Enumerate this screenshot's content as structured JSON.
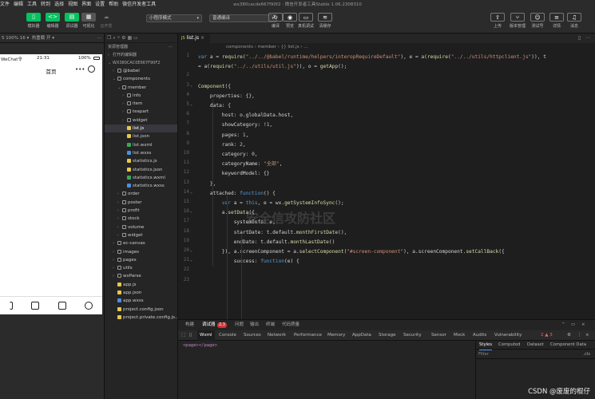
{
  "menubar": {
    "items": [
      "文件",
      "编辑",
      "工具",
      "转到",
      "选择",
      "视图",
      "界面",
      "设置",
      "帮助",
      "微信开发者工具"
    ],
    "window_title": "wx380cacde667f90f2 · 微信开发者工具Stable 1.06.2308310"
  },
  "toolbar": {
    "left_buttons": [
      "模拟器",
      "编辑器",
      "调试器",
      "可视化",
      "云开发"
    ],
    "mode_select": "小程序模式",
    "compile_select": "普通编译",
    "center_buttons": [
      "编译",
      "预览",
      "真机调试",
      "清缓存"
    ],
    "right_buttons": [
      "上传",
      "版本管理",
      "测试号",
      "详情",
      "消息"
    ]
  },
  "simulator": {
    "device_label": "5 100% 16 ▾",
    "hot_reload": "热重载 开 ▾",
    "carrier": "WeChat令",
    "time": "21:31",
    "battery": "100%",
    "page_title": "首页",
    "tabbar": [
      "",
      "",
      "",
      ""
    ]
  },
  "explorer": {
    "title": "资源管理器",
    "open_editors": "打开的编辑器",
    "project": "WX380CAC0E667F90F2",
    "tree": [
      {
        "label": "@babel",
        "depth": 1,
        "type": "folder",
        "open": false
      },
      {
        "label": "components",
        "depth": 1,
        "type": "folder",
        "open": true
      },
      {
        "label": "member",
        "depth": 2,
        "type": "folder",
        "open": true
      },
      {
        "label": "info",
        "depth": 3,
        "type": "folder",
        "open": false
      },
      {
        "label": "item",
        "depth": 3,
        "type": "folder",
        "open": false
      },
      {
        "label": "teapart",
        "depth": 3,
        "type": "folder",
        "open": false
      },
      {
        "label": "widget",
        "depth": 3,
        "type": "folder",
        "open": false
      },
      {
        "label": "list.js",
        "depth": 3,
        "type": "js",
        "selected": true
      },
      {
        "label": "list.json",
        "depth": 3,
        "type": "json"
      },
      {
        "label": "list.wxml",
        "depth": 3,
        "type": "wxml"
      },
      {
        "label": "list.wxss",
        "depth": 3,
        "type": "wxss"
      },
      {
        "label": "statistics.js",
        "depth": 3,
        "type": "js"
      },
      {
        "label": "statistics.json",
        "depth": 3,
        "type": "json"
      },
      {
        "label": "statistics.wxml",
        "depth": 3,
        "type": "wxml"
      },
      {
        "label": "statistics.wxss",
        "depth": 3,
        "type": "wxss"
      },
      {
        "label": "order",
        "depth": 2,
        "type": "folder",
        "open": false
      },
      {
        "label": "poster",
        "depth": 2,
        "type": "folder",
        "open": false
      },
      {
        "label": "profit",
        "depth": 2,
        "type": "folder",
        "open": false
      },
      {
        "label": "stock",
        "depth": 2,
        "type": "folder",
        "open": false
      },
      {
        "label": "volume",
        "depth": 2,
        "type": "folder",
        "open": false
      },
      {
        "label": "widget",
        "depth": 2,
        "type": "folder",
        "open": false
      },
      {
        "label": "ec-canvas",
        "depth": 1,
        "type": "folder",
        "open": false
      },
      {
        "label": "images",
        "depth": 1,
        "type": "folder",
        "open": false
      },
      {
        "label": "pages",
        "depth": 1,
        "type": "folder",
        "open": false
      },
      {
        "label": "utils",
        "depth": 1,
        "type": "folder",
        "open": false
      },
      {
        "label": "wxParse",
        "depth": 1,
        "type": "folder",
        "open": false
      },
      {
        "label": "app.js",
        "depth": 1,
        "type": "js"
      },
      {
        "label": "app.json",
        "depth": 1,
        "type": "json"
      },
      {
        "label": "app.wxss",
        "depth": 1,
        "type": "wxss"
      },
      {
        "label": "project.config.json",
        "depth": 1,
        "type": "json"
      },
      {
        "label": "project.private.config.js...",
        "depth": 1,
        "type": "json"
      }
    ]
  },
  "editor": {
    "tab": "list.js",
    "breadcrumb": "components › member › {} list.js › ...",
    "line_numbers": [
      "1",
      "",
      "2",
      "3",
      "4",
      "5",
      "6",
      "7",
      "8",
      "9",
      "10",
      "11",
      "12",
      "13",
      "14",
      "15",
      "16",
      "17",
      "18",
      "19",
      "20",
      "21",
      "22",
      "23"
    ],
    "code": [
      "var a = require(\"../../@babel/runtime/helpers/interopRequireDefault\"), e = a(require(\"../../utils/httpclient.js\")), t",
      "= a(require(\"../../utils/util.js\")), o = getApp();",
      "",
      "Component({",
      "    properties: {},",
      "    data: {",
      "        host: o.globalData.host,",
      "        showCategory: !1,",
      "        pages: 1,",
      "        rank: 2,",
      "        category: 0,",
      "        categoryName: \"全部\",",
      "        keywordModel: {}",
      "    },",
      "    attached: function() {",
      "        var a = this, e = wx.getSystemInfoSync();",
      "        a.setData({",
      "            systemInfo: e,",
      "            startDate: t.default.monthFirstDate(),",
      "            endDate: t.default.monthLastDate()",
      "        }), a.screenComponent = a.selectComponent(\"#screen-component\"), a.screenComponent.setCallBack({",
      "            success: function(e) {"
    ],
    "watermark": "安全信攻防社区"
  },
  "devtools": {
    "top_tabs": [
      "构建",
      "调试器",
      "问题",
      "输出",
      "终端",
      "代码质量"
    ],
    "badge": "2,3",
    "panel_tabs": [
      "Wxml",
      "Console",
      "Sources",
      "Network",
      "Performance",
      "Memory",
      "AppData",
      "Storage",
      "Security",
      "Sensor",
      "Mock",
      "Audits",
      "Vulnerability"
    ],
    "counts": "2 ▲ 3",
    "dom_text": "<page></page>",
    "style_tabs": [
      "Styles",
      "Computed",
      "Dataset",
      "Component Data"
    ],
    "filter": "Filter",
    "cls": ".cls"
  },
  "footer": {
    "credit": "CSDN @废废的棍仔"
  }
}
